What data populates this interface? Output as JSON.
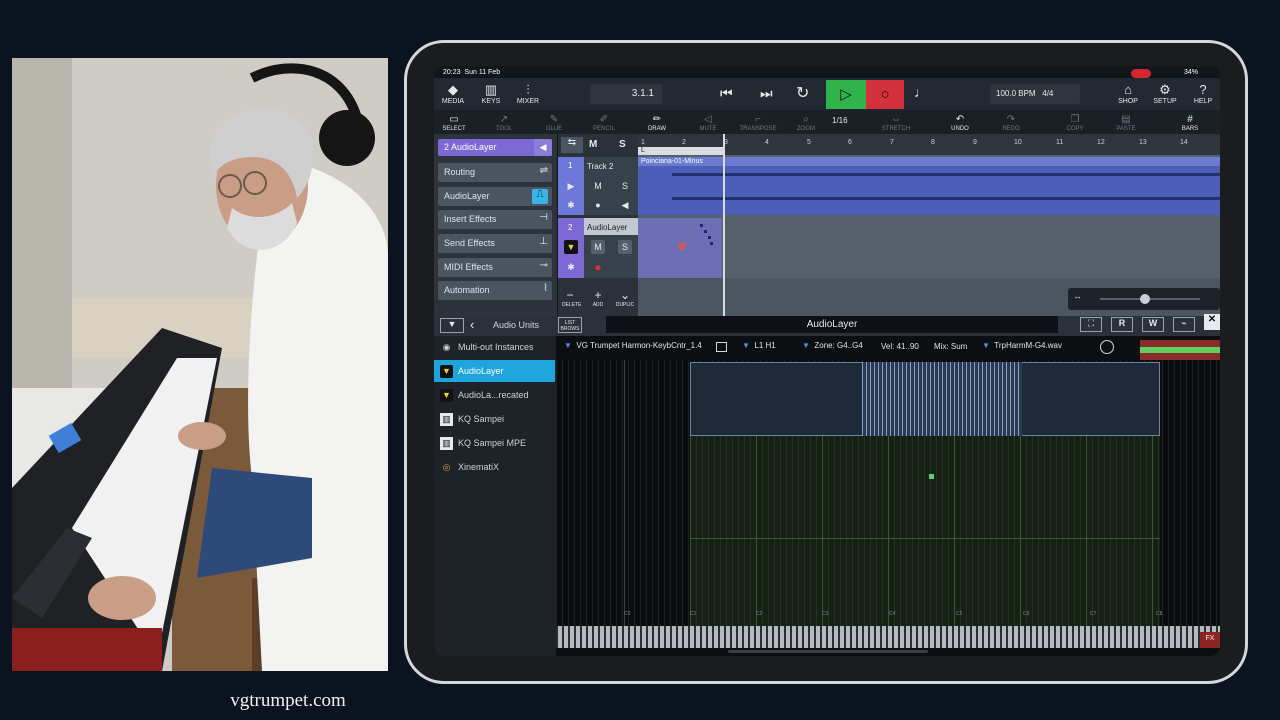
{
  "caption": "vgtrumpet.com",
  "status_bar": {
    "time": "20:23",
    "date": "Sun 11 Feb",
    "battery": "34%"
  },
  "toolbar": {
    "media": "MEDIA",
    "keys": "KEYS",
    "mixer": "MIXER",
    "position": "3.1.1",
    "bpm": "100.0 BPM",
    "signature": "4/4",
    "shop": "SHOP",
    "setup": "SETUP",
    "help": "HELP",
    "colors": {
      "play": "#2fb34a",
      "record": "#d4303d"
    }
  },
  "tools": {
    "select": "SELECT",
    "tool2": "TOOL",
    "glue": "GLUE",
    "draw2": "PENCIL",
    "erase": "ERASE",
    "draw": "DRAW",
    "mute": "MUTE",
    "transpose": "TRANSPOSE",
    "zoom": "ZOOM",
    "quantize": "1/16",
    "stretch": "STRETCH",
    "undo": "UNDO",
    "redo": "REDO",
    "copy": "COPY",
    "paste": "PASTE",
    "bars": "BARS"
  },
  "sidebar": {
    "header": "2  AudioLayer",
    "items": [
      "Routing",
      "AudioLayer",
      "Insert Effects",
      "Send Effects",
      "MIDI Effects",
      "Automation"
    ],
    "accent": "#7c69d6"
  },
  "ruler": {
    "bars": [
      "1",
      "2",
      "3",
      "4",
      "5",
      "6",
      "7",
      "8",
      "9",
      "10",
      "11",
      "12",
      "13",
      "14"
    ],
    "loop_label": "L"
  },
  "tracks": [
    {
      "number": "1",
      "name": "Track 2",
      "clip": "Poinciana-01-Minus",
      "mute": "M",
      "solo": "S"
    },
    {
      "number": "2",
      "name": "AudioLayer",
      "mute": "M",
      "solo": "S"
    }
  ],
  "track_actions": {
    "delete": "DELETE",
    "add": "ADD",
    "duplicate": "DUPLIC"
  },
  "lower_bar": {
    "back_title": "Audio Units",
    "list_label": "LIST BROWS",
    "instrument_title": "AudioLayer",
    "r": "R",
    "w": "W"
  },
  "units": [
    "Multi-out Instances",
    "AudioLayer",
    "AudioLa...recated",
    "KQ Sampei",
    "KQ Sampei MPE",
    "XinematiX"
  ],
  "layer_info": {
    "preset": "VG Trumpet Harmon-KeybCntr_1.4",
    "layer": "L1 H1",
    "zone": "Zone: G4..G4",
    "vel": "Vel: 41..90",
    "mix": "Mix: Sum",
    "file": "TrpHarmM-G4.wav"
  },
  "octaves": [
    "C0",
    "C1",
    "C2",
    "C3",
    "C4",
    "C5",
    "C6",
    "C7",
    "C8"
  ],
  "fx_label": "FX"
}
